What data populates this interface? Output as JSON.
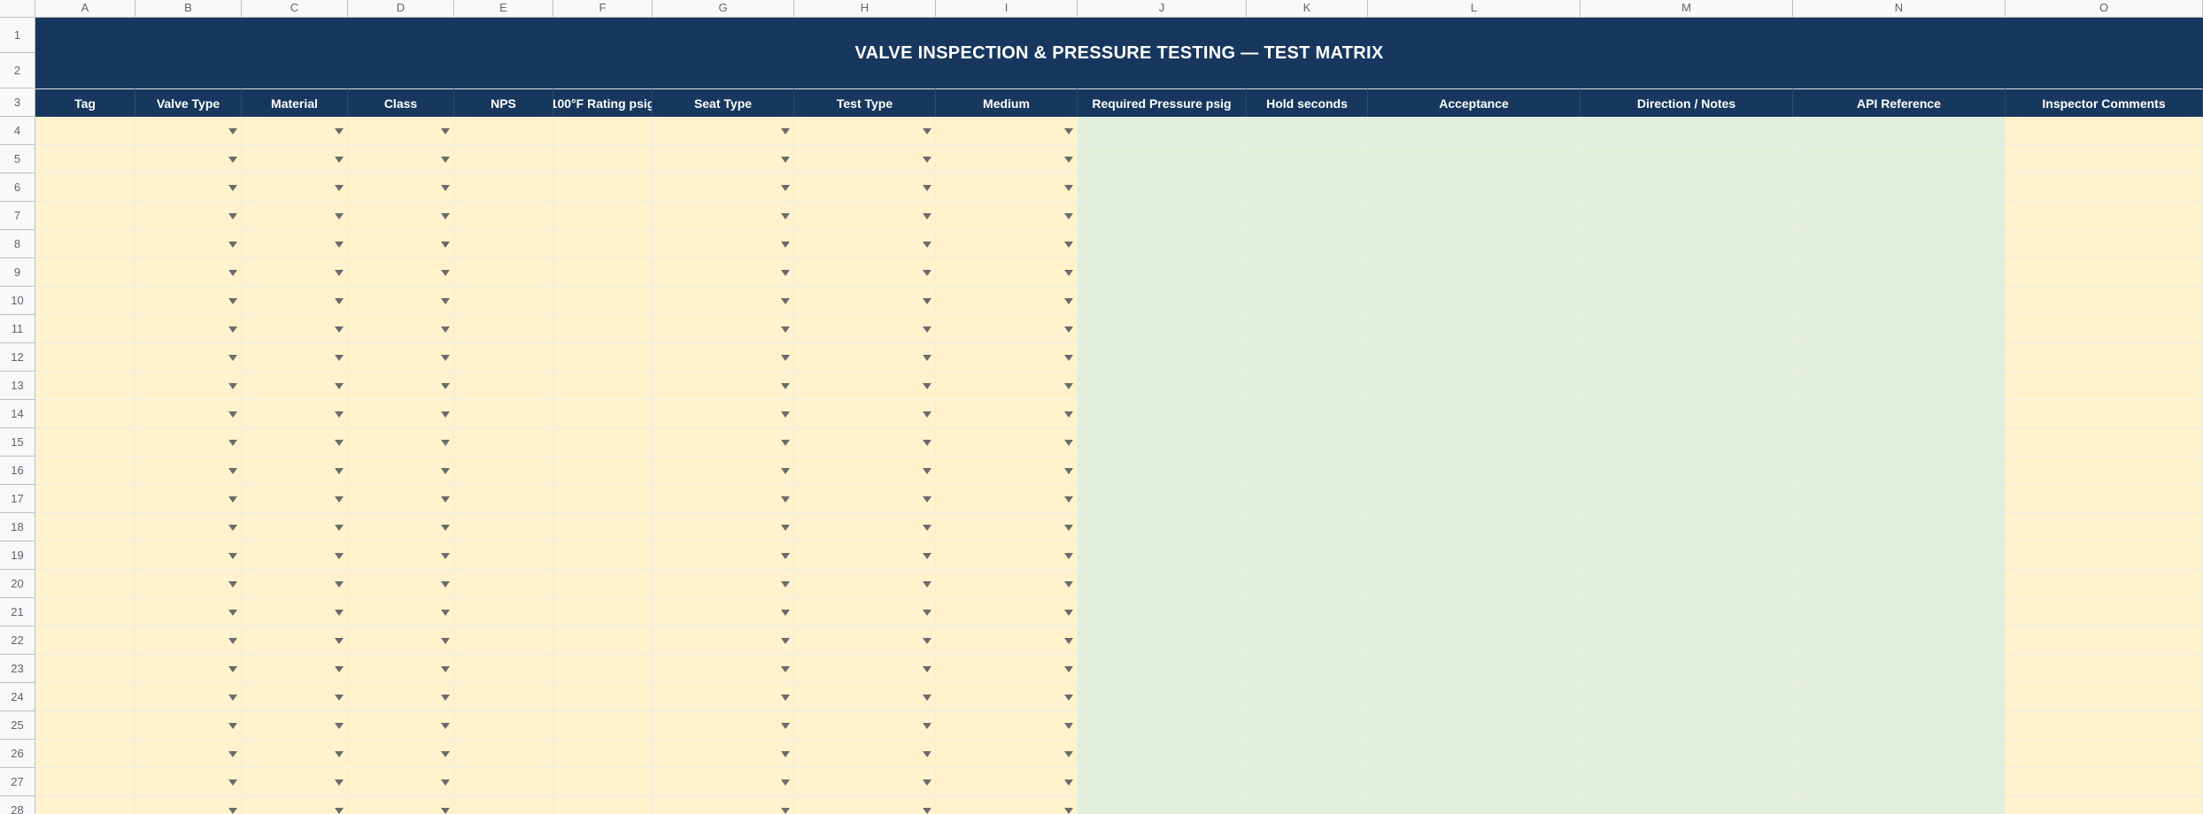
{
  "sheet": {
    "title": "VALVE INSPECTION & PRESSURE TESTING — TEST MATRIX",
    "column_letters": [
      "A",
      "B",
      "C",
      "D",
      "E",
      "F",
      "G",
      "H",
      "I",
      "J",
      "K",
      "L",
      "M",
      "N",
      "O"
    ],
    "headers": [
      "Tag",
      "Valve Type",
      "Material",
      "Class",
      "NPS",
      "100°F Rating psig",
      "Seat Type",
      "Test Type",
      "Medium",
      "Required Pressure psig",
      "Hold seconds",
      "Acceptance",
      "Direction / Notes",
      "API Reference",
      "Inspector Comments"
    ],
    "column_kinds": [
      "input",
      "dropdown",
      "dropdown",
      "dropdown",
      "input",
      "input",
      "dropdown",
      "dropdown",
      "dropdown",
      "calc",
      "calc",
      "calc",
      "calc",
      "calc",
      "input"
    ],
    "row_numbers": [
      1,
      2,
      3,
      4,
      5,
      6,
      7,
      8,
      9,
      10,
      11,
      12,
      13,
      14,
      15,
      16,
      17,
      18,
      19,
      20,
      21,
      22,
      23,
      24,
      25,
      26,
      27,
      28
    ]
  },
  "colors": {
    "header_band": "#17375e",
    "header_text": "#ffffff",
    "input_fill": "#fff2cc",
    "calc_fill": "#e2efda",
    "dropdown_arrow": "#6b6b6b"
  },
  "icons": {
    "dropdown": "chevron-down-icon"
  }
}
